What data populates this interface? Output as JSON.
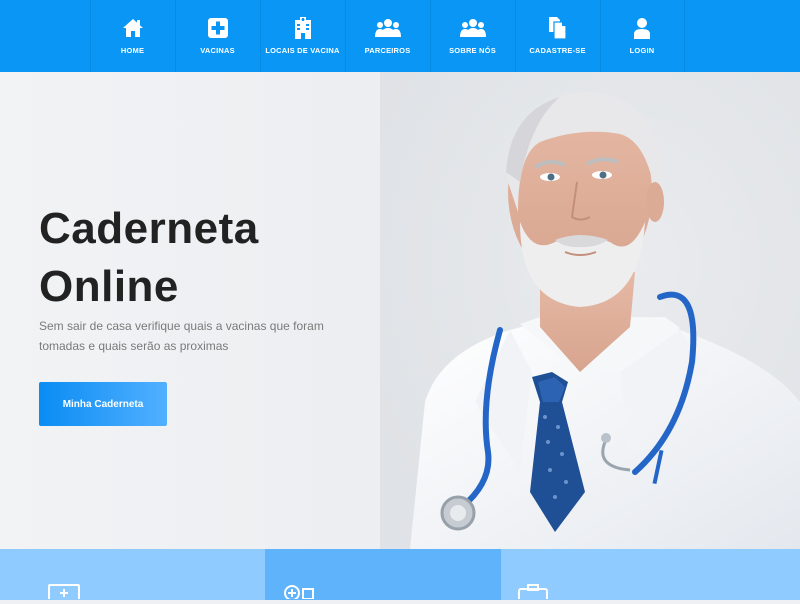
{
  "nav": {
    "items": [
      {
        "label": "HOME",
        "icon": "home-icon"
      },
      {
        "label": "VACINAS",
        "icon": "medical-plus-icon"
      },
      {
        "label": "LOCAIS DE VACINA",
        "icon": "hospital-icon"
      },
      {
        "label": "PARCEIROS",
        "icon": "users-icon"
      },
      {
        "label": "SOBRE NÓS",
        "icon": "users-icon"
      },
      {
        "label": "CADASTRE-SE",
        "icon": "documents-icon"
      },
      {
        "label": "LOGIN",
        "icon": "user-icon"
      }
    ],
    "color": "#0a96f5"
  },
  "hero": {
    "title_line1": "Caderneta",
    "title_line2": "Online",
    "subtitle": "Sem sair de casa verifique quais a vacinas que foram tomadas e quais serão as proximas",
    "button_label": "Minha Caderneta"
  },
  "features": [
    {
      "icon": "monitor-icon"
    },
    {
      "icon": "medical-kit-icon"
    },
    {
      "icon": "briefcase-icon"
    }
  ]
}
